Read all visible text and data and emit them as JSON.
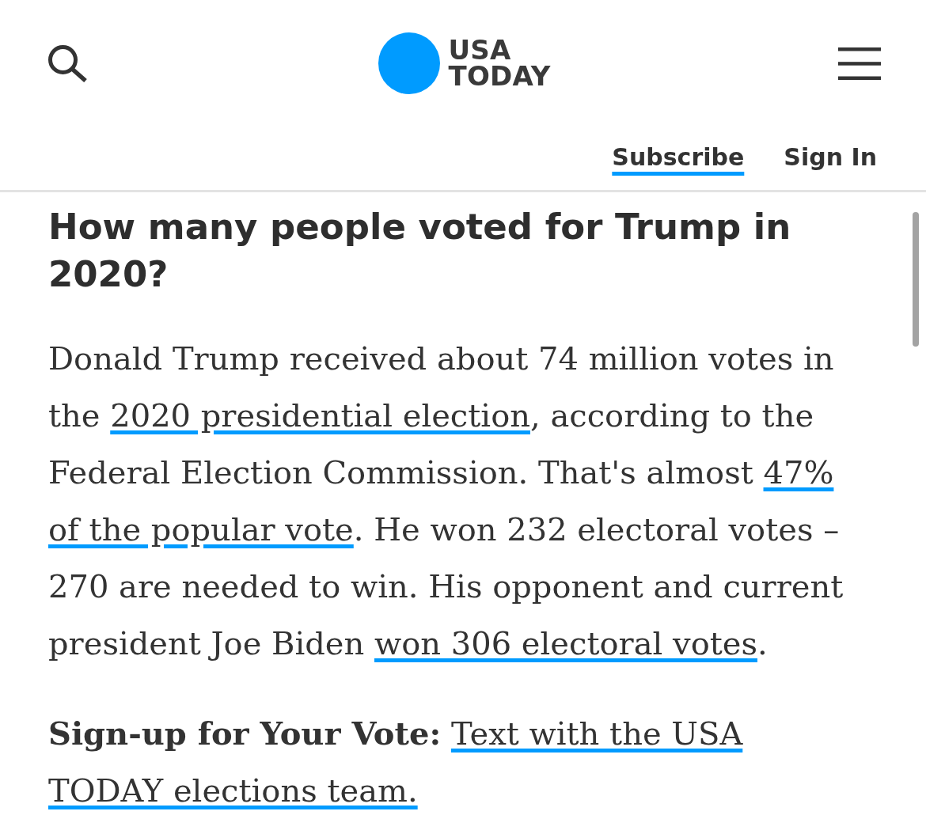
{
  "header": {
    "logo": {
      "lines": [
        "USA",
        "TODAY"
      ]
    },
    "links": [
      {
        "label": "Subscribe",
        "kind": "underlined"
      },
      {
        "label": "Sign In",
        "kind": "plain"
      }
    ]
  },
  "article": {
    "heading": "How many people voted for Trump in 2020?",
    "paragraphs": [
      {
        "lines": [
          [
            {
              "kind": "text",
              "text": "Donald Trump received about 74 million votes in"
            }
          ],
          [
            {
              "kind": "text",
              "text": "the "
            },
            {
              "kind": "link",
              "text": "2020 presidential election"
            },
            {
              "kind": "text",
              "text": ", according to the"
            }
          ],
          [
            {
              "kind": "text",
              "text": "Federal Election Commission. That's almost "
            },
            {
              "kind": "link",
              "text": "47%"
            }
          ],
          [
            {
              "kind": "link",
              "text": "of the popular vote"
            },
            {
              "kind": "text",
              "text": ". He won 232 electoral votes –"
            }
          ],
          [
            {
              "kind": "text",
              "text": "270 are needed to win. His opponent and current"
            }
          ],
          [
            {
              "kind": "text",
              "text": "president Joe Biden "
            },
            {
              "kind": "link",
              "text": "won 306 electoral votes"
            },
            {
              "kind": "text",
              "text": "."
            }
          ]
        ]
      },
      {
        "lines": [
          [
            {
              "kind": "text",
              "text": "**Sign-up for Your Vote:** "
            },
            {
              "kind": "link",
              "text": "Text with the USA"
            }
          ],
          [
            {
              "kind": "link",
              "text": "TODAY elections team."
            }
          ]
        ]
      }
    ]
  }
}
